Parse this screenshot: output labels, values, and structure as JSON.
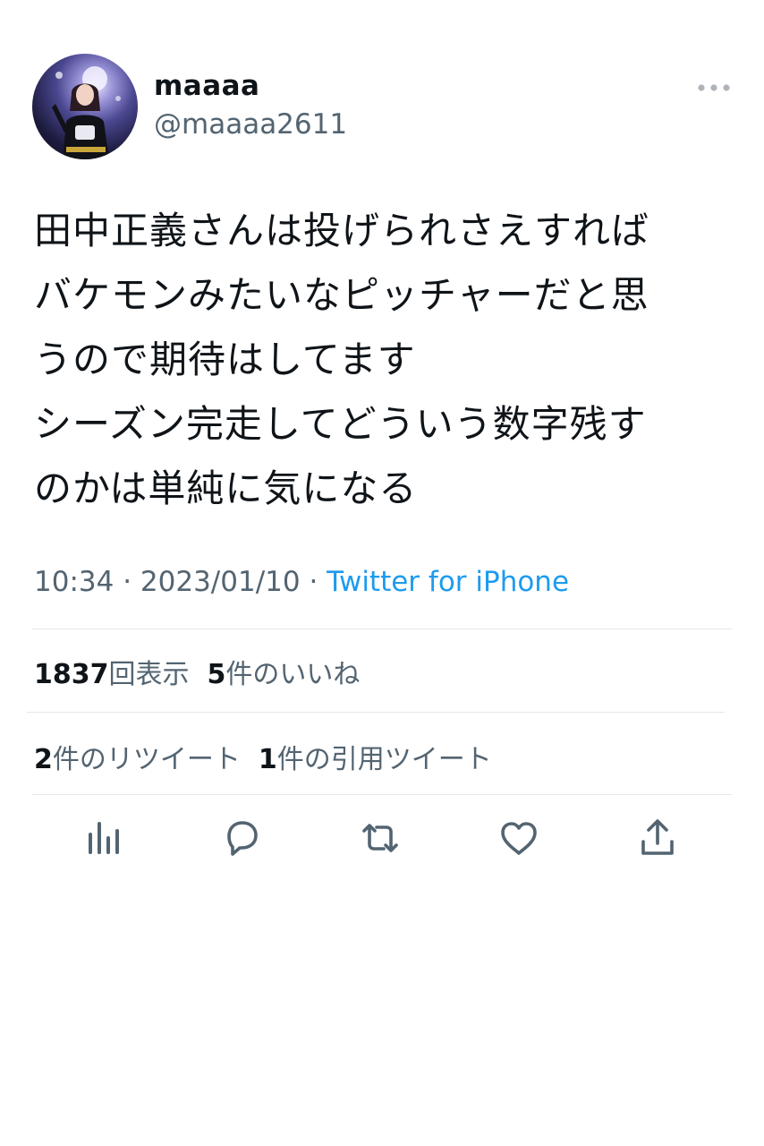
{
  "user": {
    "display_name": "maaaa",
    "handle": "@maaaa2611"
  },
  "tweet": {
    "text": "田中正義さんは投げられさえすれば\nバケモンみたいなピッチャーだと思\nうので期待はしてます\nシーズン完走してどういう数字残す\nのかは単純に気になる",
    "time": "10:34",
    "separator": " · ",
    "date": "2023/01/10",
    "source": "Twitter for iPhone"
  },
  "stats": {
    "views_count": "1837",
    "views_label": "回表示",
    "likes_count": "5",
    "likes_label": "件のいいね",
    "retweets_count": "2",
    "retweets_label": "件のリツイート",
    "quotes_count": "1",
    "quotes_label": "件の引用ツイート"
  },
  "actions": [
    {
      "icon": "analytics-icon"
    },
    {
      "icon": "reply-icon"
    },
    {
      "icon": "retweet-icon"
    },
    {
      "icon": "like-icon"
    },
    {
      "icon": "share-icon"
    }
  ],
  "colors": {
    "text": "#0f1419",
    "secondary": "#536471",
    "link": "#1d9bf0",
    "divider": "#e3e7eb"
  }
}
